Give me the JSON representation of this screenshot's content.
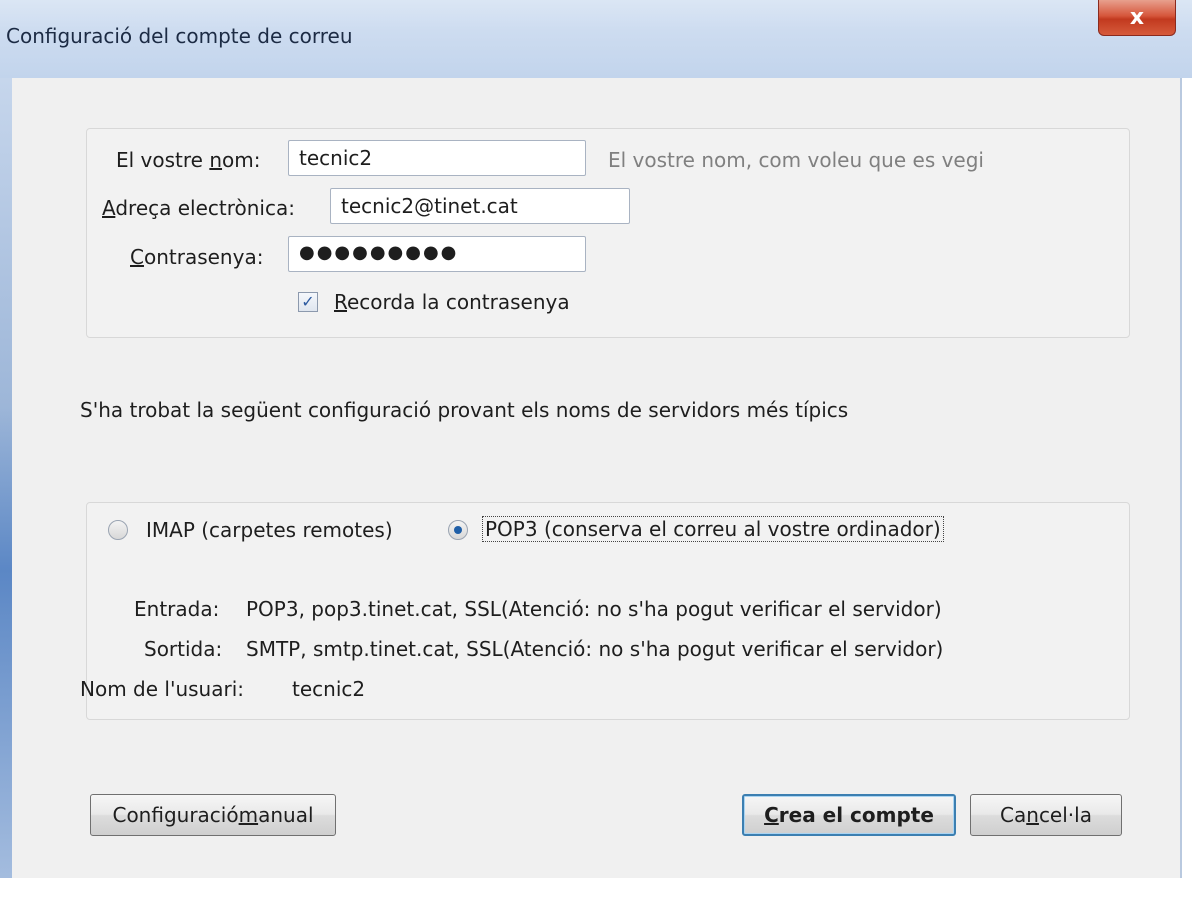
{
  "window": {
    "title": "Configuració del compte de correu",
    "close_glyph": "x"
  },
  "account": {
    "name_label_pre": "El vostre ",
    "name_label_u": "n",
    "name_label_post": "om:",
    "name_value": "tecnic2",
    "name_hint": "El vostre nom, com voleu que es vegi",
    "email_label_u": "A",
    "email_label_post": "dreça electrònica:",
    "email_value": "tecnic2@tinet.cat",
    "password_label_u": "C",
    "password_label_post": "ontrasenya:",
    "password_value": "●●●●●●●●●",
    "remember_checked": true,
    "remember_label_u": "R",
    "remember_label_post": "ecorda la contrasenya"
  },
  "found_message": "S'ha trobat la següent configuració provant els noms de servidors més típics",
  "protocol": {
    "imap_label": "IMAP (carpetes remotes)",
    "pop3_label": "POP3 (conserva el correu al vostre ordinador)",
    "selected": "pop3"
  },
  "server_info": {
    "incoming_label": "Entrada:",
    "incoming_value": "POP3, pop3.tinet.cat, SSL(Atenció: no s'ha pogut verificar el servidor)",
    "outgoing_label": "Sortida:",
    "outgoing_value": "SMTP, smtp.tinet.cat, SSL(Atenció: no s'ha pogut verificar el servidor)",
    "username_label": "Nom de l'usuari:",
    "username_value": "tecnic2"
  },
  "buttons": {
    "manual_pre": "Configuració ",
    "manual_u": "m",
    "manual_post": "anual",
    "create_u": "C",
    "create_post": "rea el compte",
    "cancel_pre": "Ca",
    "cancel_u": "n",
    "cancel_post": "cel·la"
  },
  "colors": {
    "titlebar": "#cddcf0",
    "close_button": "#c9432a",
    "default_button_border": "#3c7fb1"
  }
}
